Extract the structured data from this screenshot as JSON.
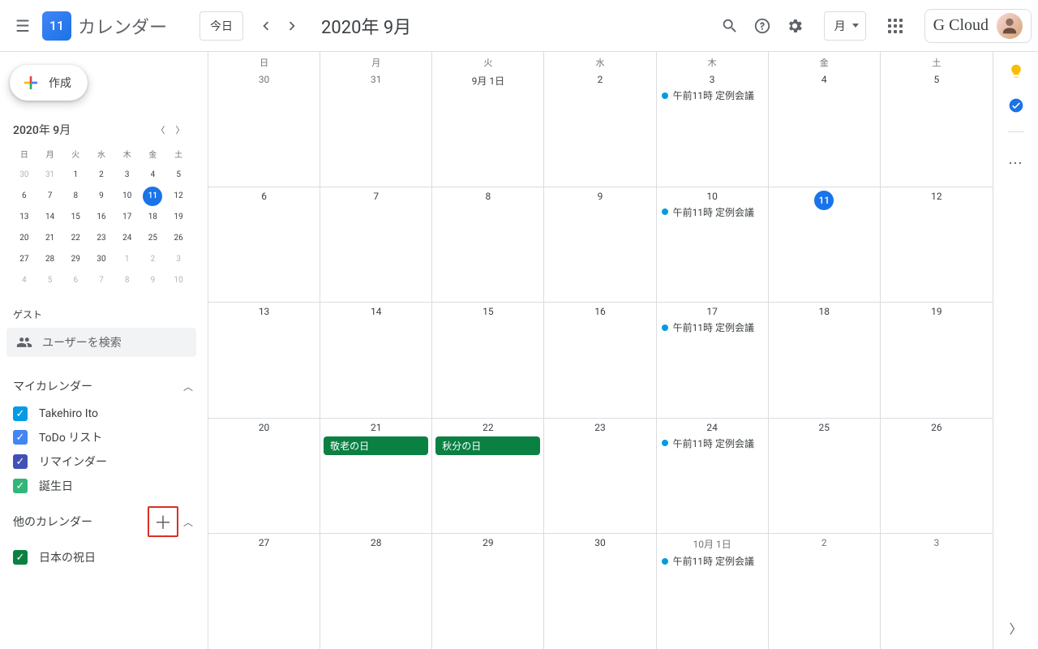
{
  "header": {
    "logo_day": "11",
    "app_title": "カレンダー",
    "today_label": "今日",
    "date_range": "2020年 9月",
    "view_label": "月",
    "brand_label": "G Cloud"
  },
  "create_btn": "作成",
  "mini_cal": {
    "title": "2020年 9月",
    "dow": [
      "日",
      "月",
      "火",
      "水",
      "木",
      "金",
      "土"
    ],
    "days": [
      {
        "n": "30",
        "o": true
      },
      {
        "n": "31",
        "o": true
      },
      {
        "n": "1"
      },
      {
        "n": "2"
      },
      {
        "n": "3"
      },
      {
        "n": "4"
      },
      {
        "n": "5"
      },
      {
        "n": "6"
      },
      {
        "n": "7"
      },
      {
        "n": "8"
      },
      {
        "n": "9"
      },
      {
        "n": "10"
      },
      {
        "n": "11",
        "sel": true
      },
      {
        "n": "12"
      },
      {
        "n": "13"
      },
      {
        "n": "14"
      },
      {
        "n": "15"
      },
      {
        "n": "16"
      },
      {
        "n": "17"
      },
      {
        "n": "18"
      },
      {
        "n": "19"
      },
      {
        "n": "20"
      },
      {
        "n": "21"
      },
      {
        "n": "22"
      },
      {
        "n": "23"
      },
      {
        "n": "24"
      },
      {
        "n": "25"
      },
      {
        "n": "26"
      },
      {
        "n": "27"
      },
      {
        "n": "28"
      },
      {
        "n": "29"
      },
      {
        "n": "30"
      },
      {
        "n": "1",
        "o": true
      },
      {
        "n": "2",
        "o": true
      },
      {
        "n": "3",
        "o": true
      },
      {
        "n": "4",
        "o": true
      },
      {
        "n": "5",
        "o": true
      },
      {
        "n": "6",
        "o": true
      },
      {
        "n": "7",
        "o": true
      },
      {
        "n": "8",
        "o": true
      },
      {
        "n": "9",
        "o": true
      },
      {
        "n": "10",
        "o": true
      }
    ]
  },
  "guest_label": "ゲスト",
  "search_placeholder": "ユーザーを検索",
  "my_calendars": {
    "title": "マイカレンダー",
    "items": [
      {
        "label": "Takehiro Ito",
        "color": "#039be5"
      },
      {
        "label": "ToDo リスト",
        "color": "#4285f4"
      },
      {
        "label": "リマインダー",
        "color": "#3f51b5"
      },
      {
        "label": "誕生日",
        "color": "#33b679"
      }
    ]
  },
  "other_calendars": {
    "title": "他のカレンダー",
    "items": [
      {
        "label": "日本の祝日",
        "color": "#0b8043"
      }
    ]
  },
  "grid": {
    "dow": [
      "日",
      "月",
      "火",
      "水",
      "木",
      "金",
      "土"
    ],
    "weeks": [
      [
        {
          "num": "30",
          "other": true
        },
        {
          "num": "31",
          "other": true
        },
        {
          "num": "9月 1日"
        },
        {
          "num": "2"
        },
        {
          "num": "3",
          "events": [
            {
              "text": "午前11時 定例会議"
            }
          ]
        },
        {
          "num": "4"
        },
        {
          "num": "5"
        }
      ],
      [
        {
          "num": "6"
        },
        {
          "num": "7"
        },
        {
          "num": "8"
        },
        {
          "num": "9"
        },
        {
          "num": "10",
          "events": [
            {
              "text": "午前11時 定例会議"
            }
          ]
        },
        {
          "num": "11",
          "today": true
        },
        {
          "num": "12"
        }
      ],
      [
        {
          "num": "13"
        },
        {
          "num": "14"
        },
        {
          "num": "15"
        },
        {
          "num": "16"
        },
        {
          "num": "17",
          "events": [
            {
              "text": "午前11時 定例会議"
            }
          ]
        },
        {
          "num": "18"
        },
        {
          "num": "19"
        }
      ],
      [
        {
          "num": "20"
        },
        {
          "num": "21",
          "holiday": "敬老の日"
        },
        {
          "num": "22",
          "holiday": "秋分の日"
        },
        {
          "num": "23"
        },
        {
          "num": "24",
          "events": [
            {
              "text": "午前11時 定例会議"
            }
          ]
        },
        {
          "num": "25"
        },
        {
          "num": "26"
        }
      ],
      [
        {
          "num": "27"
        },
        {
          "num": "28"
        },
        {
          "num": "29"
        },
        {
          "num": "30"
        },
        {
          "num": "10月 1日",
          "other": true,
          "events": [
            {
              "text": "午前11時 定例会議"
            }
          ]
        },
        {
          "num": "2",
          "other": true
        },
        {
          "num": "3",
          "other": true
        }
      ]
    ]
  }
}
